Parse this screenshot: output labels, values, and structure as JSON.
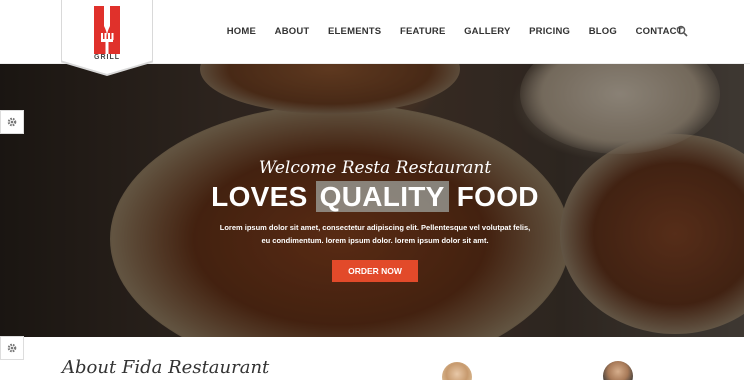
{
  "brand": {
    "name": "GRILL",
    "color": "#e0312b"
  },
  "nav": {
    "items": [
      "HOME",
      "ABOUT",
      "ELEMENTS",
      "FEATURE",
      "GALLERY",
      "PRICING",
      "BLOG",
      "CONTACT"
    ],
    "search_icon": "search-icon"
  },
  "hero": {
    "welcome": "Welcome Resta Restaurant",
    "headline_pre": "LOVES ",
    "headline_highlight": "QUALITY",
    "headline_post": " FOOD",
    "description_line1": "Lorem ipsum dolor sit amet, consectetur adipiscing elit. Pellentesque vel volutpat felis,",
    "description_line2": "eu condimentum. lorem ipsum dolor. lorem ipsum dolor sit amt.",
    "button": "ORDER NOW",
    "button_color": "#e24a2a"
  },
  "side_toggles": {
    "icon": "gear-icon"
  },
  "about": {
    "title": "About Fida Restaurant"
  }
}
